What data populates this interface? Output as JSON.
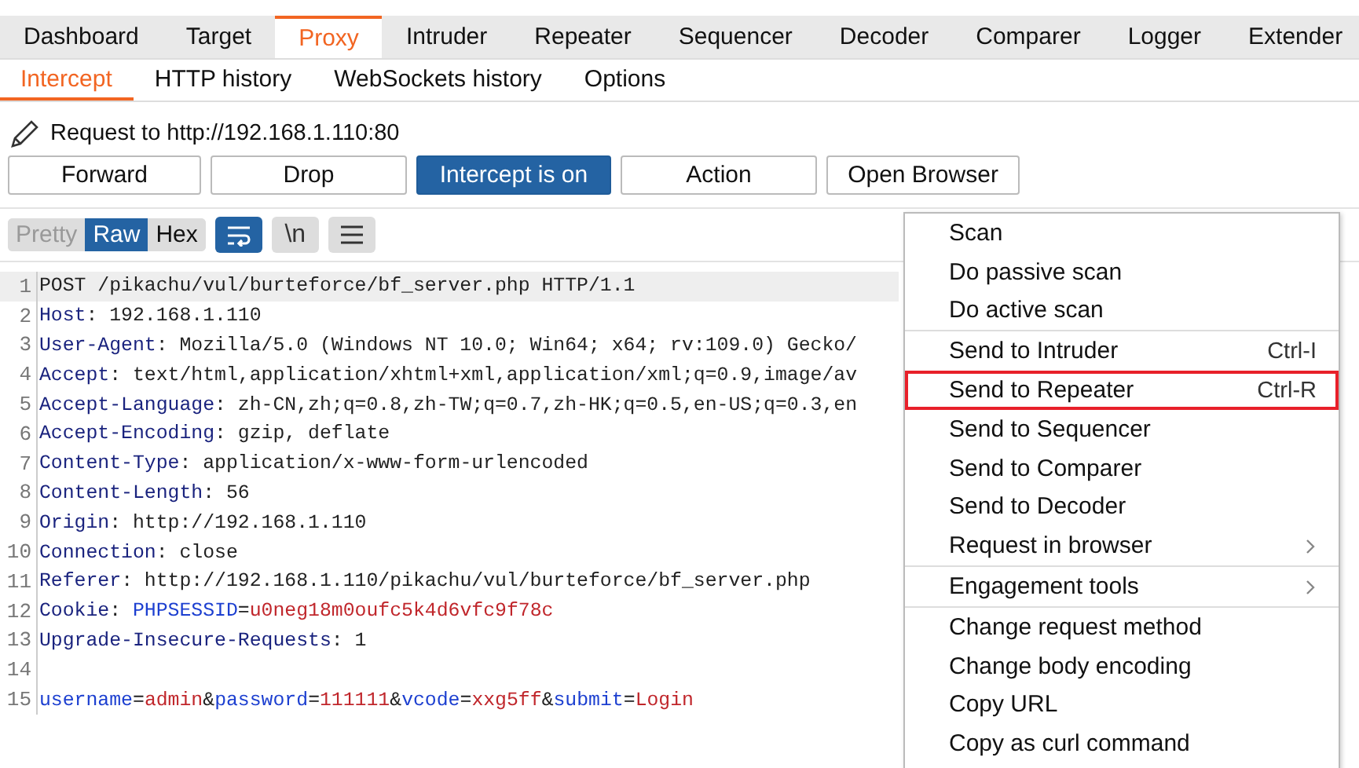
{
  "main_tabs": [
    {
      "label": "Dashboard",
      "selected": false
    },
    {
      "label": "Target",
      "selected": false
    },
    {
      "label": "Proxy",
      "selected": true
    },
    {
      "label": "Intruder",
      "selected": false
    },
    {
      "label": "Repeater",
      "selected": false
    },
    {
      "label": "Sequencer",
      "selected": false
    },
    {
      "label": "Decoder",
      "selected": false
    },
    {
      "label": "Comparer",
      "selected": false
    },
    {
      "label": "Logger",
      "selected": false
    },
    {
      "label": "Extender",
      "selected": false
    }
  ],
  "sub_tabs": [
    {
      "label": "Intercept",
      "selected": true
    },
    {
      "label": "HTTP history",
      "selected": false
    },
    {
      "label": "WebSockets history",
      "selected": false
    },
    {
      "label": "Options",
      "selected": false
    }
  ],
  "request_target": "Request to http://192.168.1.110:80",
  "buttons": [
    {
      "label": "Forward",
      "active": false
    },
    {
      "label": "Drop",
      "active": false
    },
    {
      "label": "Intercept is on",
      "active": true
    },
    {
      "label": "Action",
      "active": false
    },
    {
      "label": "Open Browser",
      "active": false
    }
  ],
  "view_tabs": [
    {
      "label": "Pretty",
      "selected": false,
      "disabled": true
    },
    {
      "label": "Raw",
      "selected": true,
      "disabled": false
    },
    {
      "label": "Hex",
      "selected": false,
      "disabled": false
    }
  ],
  "view_toggles": [
    {
      "kind": "wrap",
      "selected": true
    },
    {
      "kind": "newline",
      "label": "\\n",
      "selected": false
    },
    {
      "kind": "menu",
      "selected": false
    }
  ],
  "lines": [
    {
      "number": "1",
      "current": true,
      "segments": [
        {
          "kind": "text",
          "text": "POST /pikachu/vul/burteforce/bf_server.php HTTP/1.1"
        }
      ]
    },
    {
      "number": "2",
      "current": false,
      "segments": [
        {
          "kind": "name",
          "text": "Host"
        },
        {
          "kind": "text",
          "text": ": 192.168.1.110"
        }
      ]
    },
    {
      "number": "3",
      "current": false,
      "segments": [
        {
          "kind": "name",
          "text": "User-Agent"
        },
        {
          "kind": "text",
          "text": ": Mozilla/5.0 (Windows NT 10.0; Win64; x64; rv:109.0) Gecko/"
        }
      ]
    },
    {
      "number": "4",
      "current": false,
      "segments": [
        {
          "kind": "name",
          "text": "Accept"
        },
        {
          "kind": "text",
          "text": ": text/html,application/xhtml+xml,application/xml;q=0.9,image/av"
        }
      ]
    },
    {
      "number": "5",
      "current": false,
      "segments": [
        {
          "kind": "name",
          "text": "Accept-Language"
        },
        {
          "kind": "text",
          "text": ": zh-CN,zh;q=0.8,zh-TW;q=0.7,zh-HK;q=0.5,en-US;q=0.3,en"
        }
      ]
    },
    {
      "number": "6",
      "current": false,
      "segments": [
        {
          "kind": "name",
          "text": "Accept-Encoding"
        },
        {
          "kind": "text",
          "text": ": gzip, deflate"
        }
      ]
    },
    {
      "number": "7",
      "current": false,
      "segments": [
        {
          "kind": "name",
          "text": "Content-Type"
        },
        {
          "kind": "text",
          "text": ": application/x-www-form-urlencoded"
        }
      ]
    },
    {
      "number": "8",
      "current": false,
      "segments": [
        {
          "kind": "name",
          "text": "Content-Length"
        },
        {
          "kind": "text",
          "text": ": 56"
        }
      ]
    },
    {
      "number": "9",
      "current": false,
      "segments": [
        {
          "kind": "name",
          "text": "Origin"
        },
        {
          "kind": "text",
          "text": ": http://192.168.1.110"
        }
      ]
    },
    {
      "number": "10",
      "current": false,
      "segments": [
        {
          "kind": "name",
          "text": "Connection"
        },
        {
          "kind": "text",
          "text": ": close"
        }
      ]
    },
    {
      "number": "11",
      "current": false,
      "segments": [
        {
          "kind": "name",
          "text": "Referer"
        },
        {
          "kind": "text",
          "text": ": http://192.168.1.110/pikachu/vul/burteforce/bf_server.php"
        }
      ]
    },
    {
      "number": "12",
      "current": false,
      "segments": [
        {
          "kind": "name",
          "text": "Cookie"
        },
        {
          "kind": "text",
          "text": ": "
        },
        {
          "kind": "param",
          "text": "PHPSESSID"
        },
        {
          "kind": "text",
          "text": "="
        },
        {
          "kind": "value",
          "text": "u0neg18m0oufc5k4d6vfc9f78c"
        }
      ]
    },
    {
      "number": "13",
      "current": false,
      "segments": [
        {
          "kind": "name",
          "text": "Upgrade-Insecure-Requests"
        },
        {
          "kind": "text",
          "text": ": 1"
        }
      ]
    },
    {
      "number": "14",
      "current": false
    },
    {
      "number": "15",
      "current": false,
      "segments": [
        {
          "kind": "param",
          "text": "username"
        },
        {
          "kind": "text",
          "text": "="
        },
        {
          "kind": "value",
          "text": "admin"
        },
        {
          "kind": "text",
          "text": "&"
        },
        {
          "kind": "param",
          "text": "password"
        },
        {
          "kind": "text",
          "text": "="
        },
        {
          "kind": "value",
          "text": "111111"
        },
        {
          "kind": "text",
          "text": "&"
        },
        {
          "kind": "param",
          "text": "vcode"
        },
        {
          "kind": "text",
          "text": "="
        },
        {
          "kind": "value",
          "text": "xxg5ff"
        },
        {
          "kind": "text",
          "text": "&"
        },
        {
          "kind": "param",
          "text": "submit"
        },
        {
          "kind": "text",
          "text": "="
        },
        {
          "kind": "value",
          "text": "Login"
        }
      ]
    }
  ],
  "context_menu": [
    [
      {
        "label": "Scan",
        "highlighted": false,
        "submenu": false
      },
      {
        "label": "Do passive scan",
        "highlighted": false,
        "submenu": false
      },
      {
        "label": "Do active scan",
        "highlighted": false,
        "submenu": false
      }
    ],
    [
      {
        "label": "Send to Intruder",
        "shortcut": "Ctrl-I",
        "highlighted": false,
        "submenu": false
      },
      {
        "label": "Send to Repeater",
        "shortcut": "Ctrl-R",
        "highlighted": true,
        "submenu": false
      },
      {
        "label": "Send to Sequencer",
        "highlighted": false,
        "submenu": false
      },
      {
        "label": "Send to Comparer",
        "highlighted": false,
        "submenu": false
      },
      {
        "label": "Send to Decoder",
        "highlighted": false,
        "submenu": false
      },
      {
        "label": "Request in browser",
        "highlighted": false,
        "submenu": true
      }
    ],
    [
      {
        "label": "Engagement tools",
        "highlighted": false,
        "submenu": true
      }
    ],
    [
      {
        "label": "Change request method",
        "highlighted": false,
        "submenu": false
      },
      {
        "label": "Change body encoding",
        "highlighted": false,
        "submenu": false
      },
      {
        "label": "Copy URL",
        "highlighted": false,
        "submenu": false
      },
      {
        "label": "Copy as curl command",
        "highlighted": false,
        "submenu": false
      }
    ]
  ]
}
